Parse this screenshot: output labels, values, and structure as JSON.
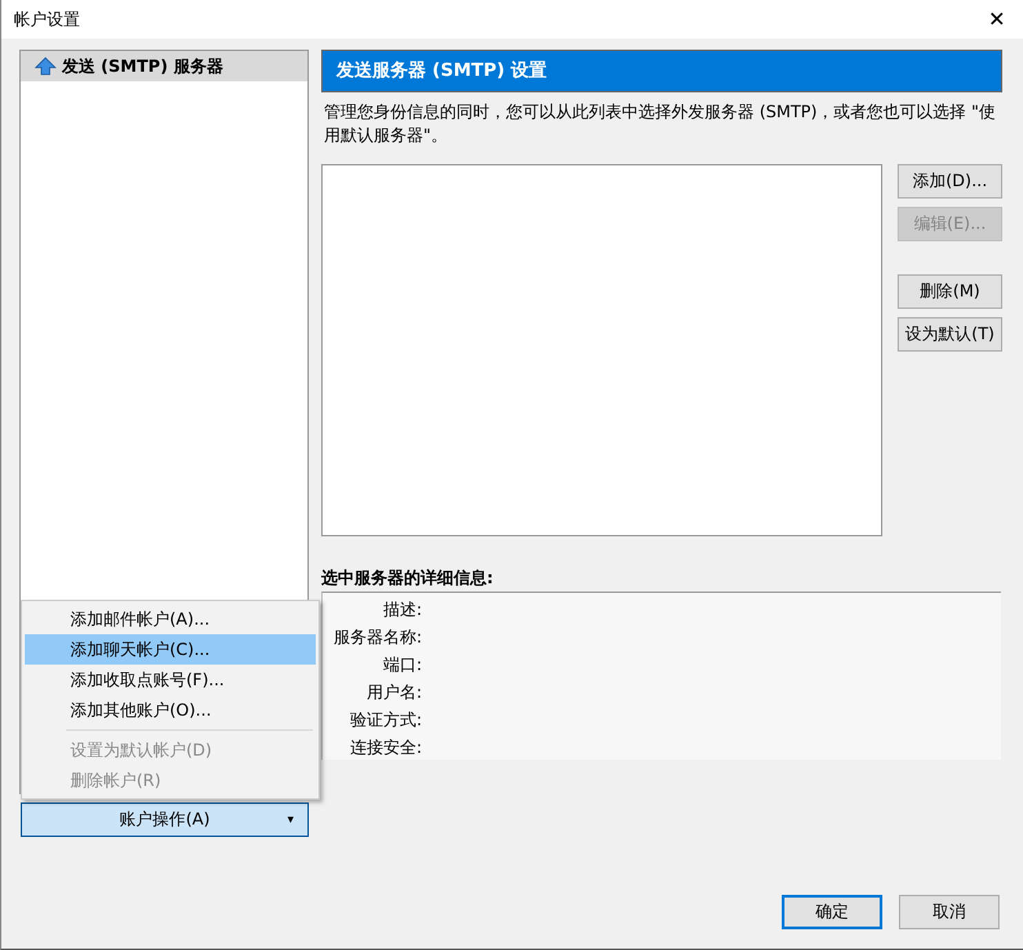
{
  "window": {
    "title": "帐户设置",
    "close": "✕"
  },
  "sidebar": {
    "items": [
      {
        "label": "发送 (SMTP) 服务器",
        "selected": true
      }
    ]
  },
  "account_actions": {
    "label": "账户操作(A)",
    "caret": "▾",
    "expanded": true,
    "menu": [
      {
        "kind": "item",
        "label": "添加邮件帐户(A)...",
        "disabled": false,
        "selected": false
      },
      {
        "kind": "item",
        "label": "添加聊天帐户(C)...",
        "disabled": false,
        "selected": true
      },
      {
        "kind": "item",
        "label": "添加收取点账号(F)...",
        "disabled": false,
        "selected": false
      },
      {
        "kind": "item",
        "label": "添加其他账户(O)...",
        "disabled": false,
        "selected": false
      },
      {
        "kind": "separator"
      },
      {
        "kind": "item",
        "label": "设置为默认帐户(D)",
        "disabled": true,
        "selected": false
      },
      {
        "kind": "item",
        "label": "删除帐户(R)",
        "disabled": true,
        "selected": false
      }
    ]
  },
  "panel": {
    "title": "发送服务器 (SMTP) 设置",
    "description": "管理您身份信息的同时，您可以从此列表中选择外发服务器 (SMTP)，或者您也可以选择 \"使用默认服务器\"。",
    "button_groups": [
      [
        {
          "label": "添加(D)...",
          "disabled": false
        },
        {
          "label": "编辑(E)...",
          "disabled": true
        }
      ],
      [
        {
          "label": "删除(M)",
          "disabled": false
        },
        {
          "label": "设为默认(T)",
          "disabled": false
        }
      ]
    ],
    "details_title": "选中服务器的详细信息:",
    "details": [
      "描述:",
      "服务器名称:",
      "端口:",
      "用户名:",
      "验证方式:",
      "连接安全:"
    ]
  },
  "footer": {
    "buttons": [
      {
        "label": "确定",
        "default": true
      },
      {
        "label": "取消",
        "default": false
      }
    ]
  }
}
